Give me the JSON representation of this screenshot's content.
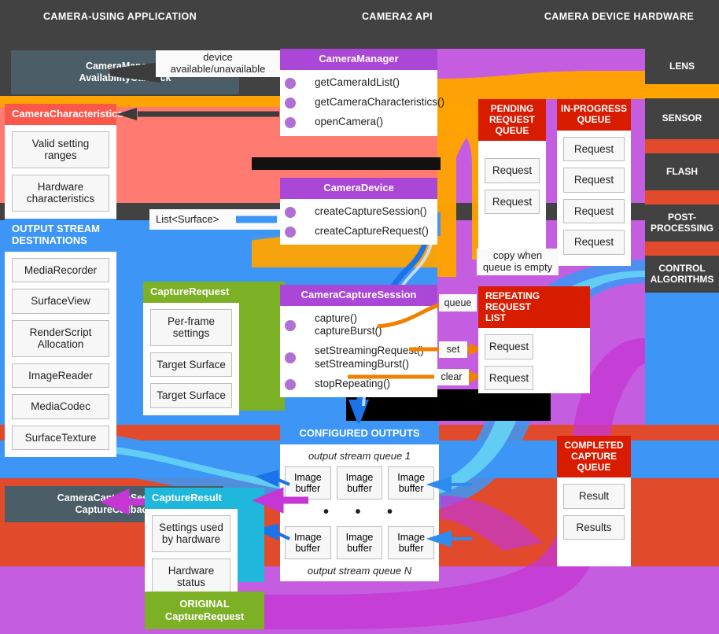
{
  "columns": [
    {
      "label": "CAMERA-USING APPLICATION"
    },
    {
      "label": "CAMERA2 API"
    },
    {
      "label": "CAMERA DEVICE HARDWARE"
    }
  ],
  "callbacks": {
    "availability": "CameraManager.\nAvailabilityCallback",
    "capture": "CameraCaptureSession.\nCaptureCallback"
  },
  "labels": {
    "device_availability": "device\navailable/unavailable",
    "list_surface": "List<Surface>",
    "copy_when_empty": "copy when\nqueue is empty",
    "queue": "queue",
    "set": "set",
    "clear": "clear"
  },
  "camera_characteristics": {
    "title": "CameraCharacteristics",
    "items": [
      "Valid setting\nranges",
      "Hardware\ncharacteristics"
    ]
  },
  "output_streams": {
    "title": "OUTPUT STREAM\nDESTINATIONS",
    "items": [
      "MediaRecorder",
      "SurfaceView",
      "RenderScript\nAllocation",
      "ImageReader",
      "MediaCodec",
      "SurfaceTexture"
    ]
  },
  "camera_manager": {
    "title": "CameraManager",
    "methods": [
      "getCameraIdList()",
      "getCameraCharacteristics()",
      "openCamera()"
    ]
  },
  "camera_device": {
    "title": "CameraDevice",
    "methods": [
      "createCaptureSession()",
      "createCaptureRequest()"
    ]
  },
  "capture_request": {
    "title": "CaptureRequest",
    "items": [
      "Per-frame\nsettings",
      "Target Surface",
      "Target Surface"
    ]
  },
  "capture_session": {
    "title": "CameraCaptureSession",
    "methods": [
      "capture()\ncaptureBurst()",
      "setStreamingRequest()\nsetStreamingBurst()",
      "stopRepeating()"
    ]
  },
  "pending_queue": {
    "title": "PENDING\nREQUEST\nQUEUE",
    "items": [
      "Request",
      "Request"
    ]
  },
  "inprogress_queue": {
    "title": "IN-PROGRESS\nQUEUE",
    "items": [
      "Request",
      "Request",
      "Request",
      "Request"
    ]
  },
  "repeating_list": {
    "title": "REPEATING\nREQUEST\nLIST",
    "items": [
      "Request",
      "Request"
    ]
  },
  "configured_outputs": {
    "title": "CONFIGURED OUTPUTS",
    "queue_first": "output stream queue 1",
    "queue_last": "output stream queue N",
    "ellipsis": "• • •",
    "buffers_first": [
      "Image\nbuffer",
      "Image\nbuffer",
      "Image\nbuffer"
    ],
    "buffers_last": [
      "Image\nbuffer",
      "Image\nbuffer",
      "Image\nbuffer"
    ]
  },
  "completed_queue": {
    "title": "COMPLETED\nCAPTURE\nQUEUE",
    "items": [
      "Result",
      "Results"
    ]
  },
  "capture_result": {
    "title": "CaptureResult",
    "items": [
      "Settings used\nby hardware",
      "Hardware\nstatus"
    ]
  },
  "original_request": {
    "title": "ORIGINAL\nCaptureRequest"
  },
  "hardware": [
    {
      "label": "LENS"
    },
    {
      "label": "SENSOR"
    },
    {
      "label": "FLASH"
    },
    {
      "label": "POST-\nPROCESSING"
    },
    {
      "label": "CONTROL\nALGORITHMS"
    }
  ],
  "colors": {
    "background": "#424242",
    "orange": "#ffa300",
    "salmon": "#ff7a70",
    "blue": "#3d96f5",
    "red": "#e14a2b",
    "purple": "#c45de0",
    "green": "#7cb025",
    "cyan": "#20b7dc",
    "deep_red": "#d81c00",
    "title_purple": "#ab47d6",
    "dot_purple": "#b06fd4",
    "callback_slate": "#4b5d66"
  }
}
